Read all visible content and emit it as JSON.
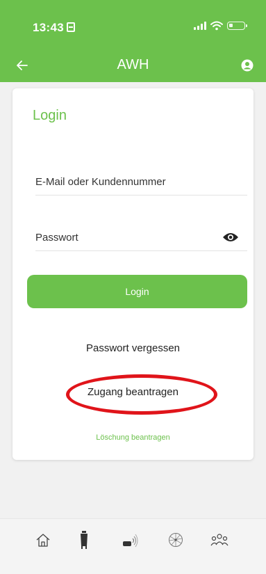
{
  "status_bar": {
    "time": "13:43"
  },
  "app_bar": {
    "title": "AWH",
    "back_icon": "arrow-left-icon",
    "profile_icon": "user-circle-icon"
  },
  "colors": {
    "brand": "#6cc14c",
    "annotation": "#e0141a"
  },
  "login_card": {
    "heading": "Login",
    "email": {
      "placeholder": "E-Mail oder Kundennummer",
      "value": ""
    },
    "password": {
      "placeholder": "Passwort",
      "value": "",
      "toggle_icon": "eye-icon"
    },
    "login_button": "Login",
    "forgot_password": "Passwort vergessen",
    "request_access": "Zugang beantragen",
    "request_deletion": "Löschung beantragen"
  },
  "bottom_nav": {
    "items": [
      {
        "icon": "home-icon"
      },
      {
        "icon": "bin-icon"
      },
      {
        "icon": "sensor-icon"
      },
      {
        "icon": "network-icon"
      },
      {
        "icon": "people-icon"
      }
    ]
  }
}
